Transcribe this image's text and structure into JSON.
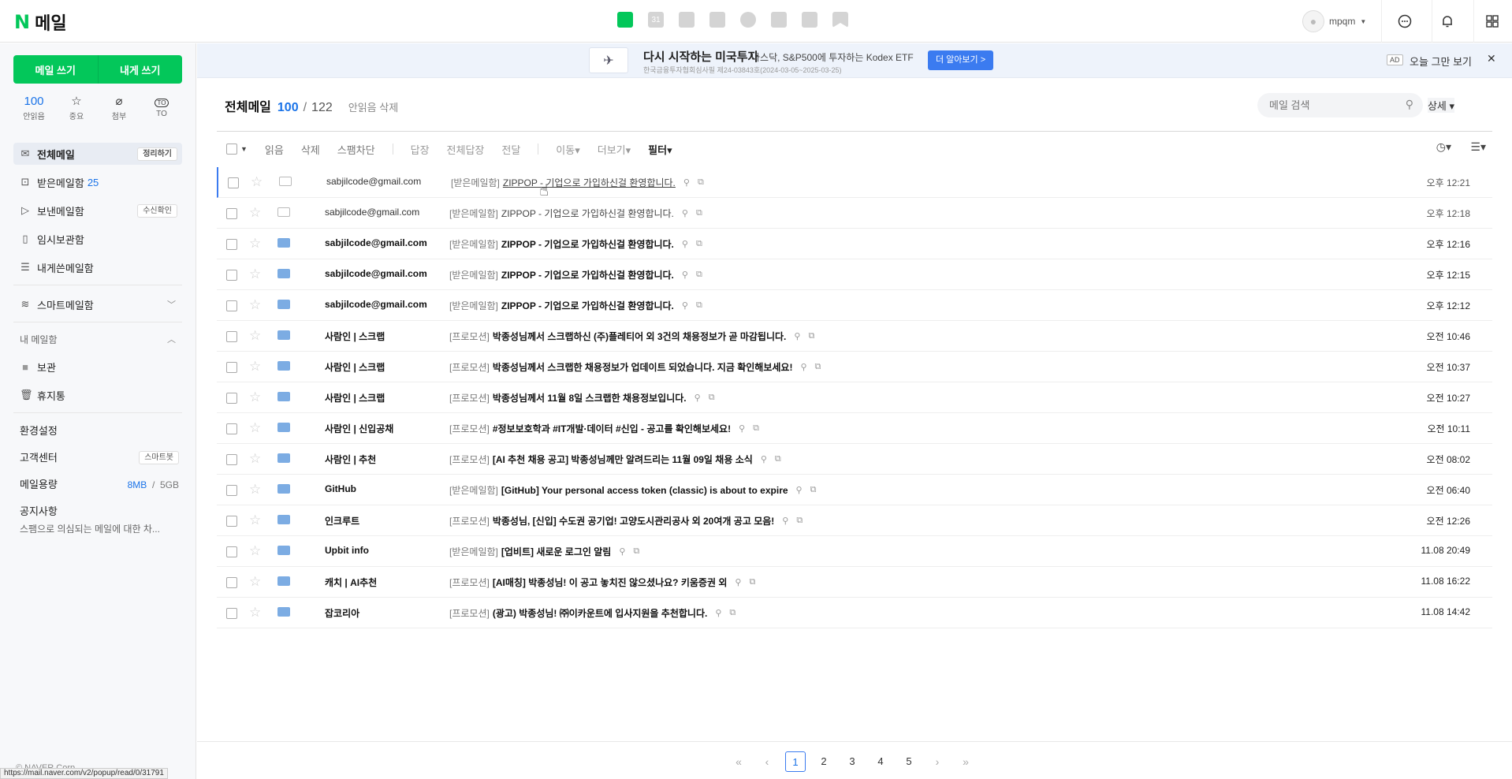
{
  "header": {
    "logo_n": "N",
    "logo_text": "메일",
    "apps": [
      {
        "icon": "mail-icon",
        "active": true
      },
      {
        "icon": "calendar-icon",
        "label": "31"
      },
      {
        "icon": "photo-icon"
      },
      {
        "icon": "contacts-icon"
      },
      {
        "icon": "cube-icon"
      },
      {
        "icon": "todo-icon"
      },
      {
        "icon": "home-icon"
      },
      {
        "icon": "bookmark-icon"
      }
    ],
    "user": "mpqm"
  },
  "sidebar": {
    "write_mail": "메일 쓰기",
    "write_self": "내게 쓰기",
    "quick": [
      {
        "top": "100",
        "label": "안읽음"
      },
      {
        "top": "☆",
        "label": "중요"
      },
      {
        "top": "⌀",
        "label": "첨부"
      },
      {
        "top": "TO",
        "label": "TO"
      }
    ],
    "folders": [
      {
        "label": "전체메일",
        "pill": "정리하기",
        "selected": true
      },
      {
        "label": "받은메일함",
        "count": "25"
      },
      {
        "label": "보낸메일함",
        "pill": "수신확인"
      },
      {
        "label": "임시보관함"
      },
      {
        "label": "내게쓴메일함"
      }
    ],
    "smart": "스마트메일함",
    "my_mail": "내 메일함",
    "my_folders": [
      {
        "label": "보관"
      },
      {
        "label": "휴지통"
      }
    ],
    "settings": "환경설정",
    "support": "고객센터",
    "support_pill": "스마트봇",
    "capacity_label": "메일용량",
    "capacity_used": "8MB",
    "capacity_sep": "/",
    "capacity_total": "5GB",
    "notice_title": "공지사항",
    "notice_text": "스팸으로 의심되는 메일에 대한 차...",
    "copyright": "© NAVER Corp."
  },
  "ad": {
    "headline": "다시 시작하는 미국투자",
    "sub": "나스닥, S&P500에 투자하는 Kodex ETF",
    "small": "한국금융투자협회심사필 제24-03843호(2024-03-05~2025-03-25)",
    "more": "더 알아보기 >",
    "ad_tag": "AD",
    "hide_today": "오늘 그만 보기",
    "close": "✕"
  },
  "list": {
    "title": "전체메일",
    "unread": "100",
    "slash": "/",
    "total": "122",
    "delete_unread": "안읽음 삭제",
    "search_placeholder": "메일 검색",
    "detail": "상세 ▾"
  },
  "toolbar": {
    "read": "읽음",
    "delete": "삭제",
    "spam": "스팸차단",
    "reply": "답장",
    "reply_all": "전체답장",
    "forward": "전달",
    "move": "이동▾",
    "more": "더보기▾",
    "filter": "필터▾"
  },
  "mails": [
    {
      "sender": "sabjilcode@gmail.com",
      "cat": "[받은메일함]",
      "subject": "ZIPPOP - 기업으로 가입하신걸 환영합니다.",
      "time": "오후 12:21",
      "unread": false
    },
    {
      "sender": "sabjilcode@gmail.com",
      "cat": "[받은메일함]",
      "subject": "ZIPPOP - 기업으로 가입하신걸 환영합니다.",
      "time": "오후 12:18",
      "unread": false
    },
    {
      "sender": "sabjilcode@gmail.com",
      "cat": "[받은메일함]",
      "subject": "ZIPPOP - 기업으로 가입하신걸 환영합니다.",
      "time": "오후 12:16",
      "unread": true
    },
    {
      "sender": "sabjilcode@gmail.com",
      "cat": "[받은메일함]",
      "subject": "ZIPPOP - 기업으로 가입하신걸 환영합니다.",
      "time": "오후 12:15",
      "unread": true
    },
    {
      "sender": "sabjilcode@gmail.com",
      "cat": "[받은메일함]",
      "subject": "ZIPPOP - 기업으로 가입하신걸 환영합니다.",
      "time": "오후 12:12",
      "unread": true
    },
    {
      "sender": "사람인 | 스크랩",
      "cat": "[프로모션]",
      "subject": "박종성님께서 스크랩하신 (주)플레티어 외 3건의 채용정보가 곧 마감됩니다.",
      "time": "오전 10:46",
      "unread": true
    },
    {
      "sender": "사람인 | 스크랩",
      "cat": "[프로모션]",
      "subject": "박종성님께서 스크랩한 채용정보가 업데이트 되었습니다. 지금 확인해보세요!",
      "time": "오전 10:37",
      "unread": true
    },
    {
      "sender": "사람인 | 스크랩",
      "cat": "[프로모션]",
      "subject": "박종성님께서 11월 8일 스크랩한 채용정보입니다.",
      "time": "오전 10:27",
      "unread": true
    },
    {
      "sender": "사람인 | 신입공채",
      "cat": "[프로모션]",
      "subject": "#정보보호학과 #IT개발·데이터 #신입 - 공고를 확인해보세요!",
      "time": "오전 10:11",
      "unread": true
    },
    {
      "sender": "사람인 | 추천",
      "cat": "[프로모션]",
      "subject": "[AI 추천 채용 공고] 박종성님께만 알려드리는 11월 09일 채용 소식",
      "time": "오전 08:02",
      "unread": true
    },
    {
      "sender": "GitHub",
      "cat": "[받은메일함]",
      "subject": "[GitHub] Your personal access token (classic) is about to expire",
      "time": "오전 06:40",
      "unread": true
    },
    {
      "sender": "인크루트",
      "cat": "[프로모션]",
      "subject": "박종성님, [신입] 수도권 공기업! 고양도시관리공사 외 20여개 공고 모음!",
      "time": "오전 12:26",
      "unread": true
    },
    {
      "sender": "Upbit info",
      "cat": "[받은메일함]",
      "subject": "[업비트] 새로운 로그인 알림",
      "time": "11.08 20:49",
      "unread": true
    },
    {
      "sender": "캐치 | AI추천",
      "cat": "[프로모션]",
      "subject": "[AI매칭] 박종성님! 이 공고 놓치진 않으셨나요? 키움증권 외",
      "time": "11.08 16:22",
      "unread": true
    },
    {
      "sender": "잡코리아",
      "cat": "[프로모션]",
      "subject": "(광고) 박종성님! ㈜이카운트에 입사지원을 추천합니다.",
      "time": "11.08 14:42",
      "unread": true
    }
  ],
  "pager": {
    "pages": [
      "1",
      "2",
      "3",
      "4",
      "5"
    ],
    "current": "1"
  },
  "status_url": "https://mail.naver.com/v2/popup/read/0/31791"
}
